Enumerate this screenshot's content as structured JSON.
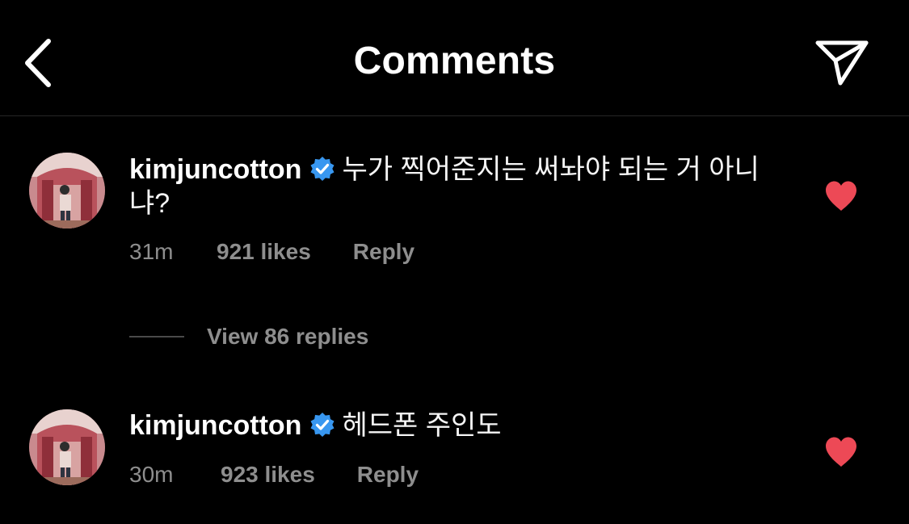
{
  "header": {
    "title": "Comments",
    "back_icon": "chevron-left-icon",
    "share_icon": "paper-plane-icon"
  },
  "colors": {
    "background": "#000000",
    "text_primary": "#ffffff",
    "text_secondary": "#8e8e8e",
    "verified_badge": "#3897f0",
    "like_heart": "#ed4956",
    "divider": "#262626"
  },
  "comments": [
    {
      "username": "kimjuncotton",
      "verified": true,
      "text": "누가 찍어준지는 써놔야 되는 거 아니냐?",
      "time": "31m",
      "likes": "921 likes",
      "reply_label": "Reply",
      "liked": true
    },
    {
      "username": "kimjuncotton",
      "verified": true,
      "text": "헤드폰 주인도",
      "time": "30m",
      "likes": "923 likes",
      "reply_label": "Reply",
      "liked": true
    }
  ],
  "replies_toggle": {
    "label": "View 86 replies"
  }
}
